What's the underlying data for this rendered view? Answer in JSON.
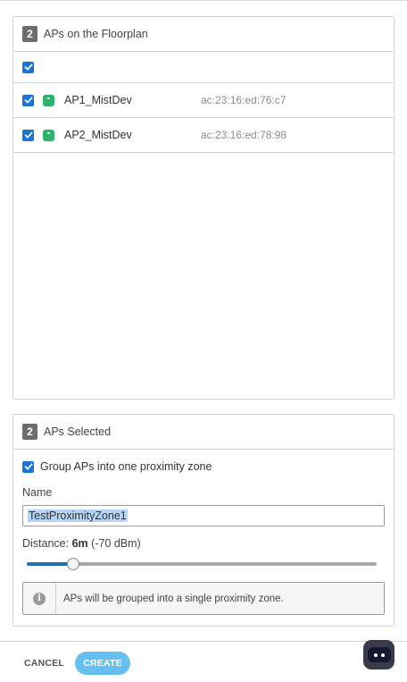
{
  "floorplan_panel": {
    "count": "2",
    "title": "APs on the Floorplan",
    "select_all_checked": true,
    "aps": [
      {
        "name": "AP1_MistDev",
        "mac": "ac:23:16:ed:76:c7",
        "checked": true
      },
      {
        "name": "AP2_MistDev",
        "mac": "ac:23:16:ed:78:98",
        "checked": true
      }
    ]
  },
  "selected_panel": {
    "count": "2",
    "title": "APs Selected",
    "group_label": "Group APs into one proximity zone",
    "group_checked": true,
    "name_label": "Name",
    "name_value": "TestProximityZone1",
    "distance_label": "Distance:",
    "distance_value": "6m",
    "distance_dbm": "(-70 dBm)",
    "slider_fraction": 0.133,
    "info_text": "APs will be grouped into a single proximity zone."
  },
  "footer": {
    "cancel_label": "CANCEL",
    "create_label": "CREATE"
  },
  "colors": {
    "accent": "#1a73d8",
    "create_button": "#65c0ef",
    "ap_status": "#2db36b"
  }
}
